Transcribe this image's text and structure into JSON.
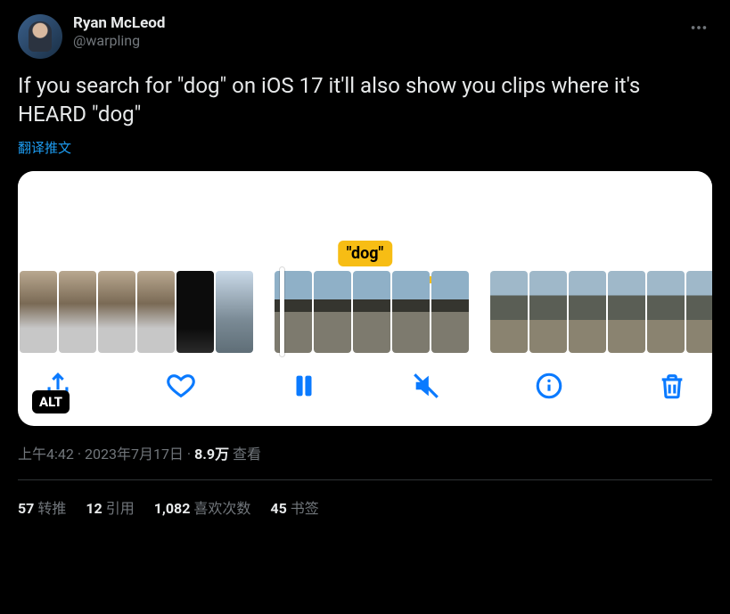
{
  "author": {
    "display_name": "Ryan McLeod",
    "handle": "@warpling"
  },
  "tweet_text": "If you search for \"dog\" on iOS 17 it'll also show you clips where it's HEARD \"dog\"",
  "translate_label": "翻译推文",
  "media": {
    "search_tag": "\"dog\"",
    "alt_badge": "ALT",
    "toolbar": {
      "share": "share",
      "like": "like",
      "pause": "pause",
      "mute": "mute",
      "info": "info",
      "delete": "delete"
    }
  },
  "meta": {
    "time": "上午4:42",
    "date": "2023年7月17日",
    "views_num": "8.9万",
    "views_label": "查看"
  },
  "stats": {
    "retweets_num": "57",
    "retweets_label": "转推",
    "quotes_num": "12",
    "quotes_label": "引用",
    "likes_num": "1,082",
    "likes_label": "喜欢次数",
    "bookmarks_num": "45",
    "bookmarks_label": "书签"
  }
}
